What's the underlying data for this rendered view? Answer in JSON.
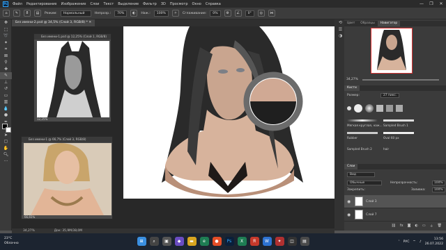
{
  "menu": {
    "items": [
      "Файл",
      "Редактирование",
      "Изображение",
      "Слои",
      "Текст",
      "Выделение",
      "Фильтр",
      "3D",
      "Просмотр",
      "Окно",
      "Справка"
    ]
  },
  "window_controls": [
    "—",
    "❐",
    "✕"
  ],
  "options_bar": {
    "brush_size": "8",
    "mode_label": "Режим:",
    "mode_value": "Нормальный",
    "opacity_label": "Непрозр.:",
    "opacity_value": "70%",
    "flow_label": "Наж.:",
    "flow_value": "100%",
    "smoothing_label": "Сглаживание:",
    "smoothing_value": "0%",
    "angle_value": "0°"
  },
  "document": {
    "tab_title": "Без имени-2.psd @ 34,5% (Слой 3, RGB/8) *",
    "status_zoom": "34,27%",
    "status_doc": "Док: 35,9М/38,0М"
  },
  "float_doc_1": {
    "title": "Без имени-1.psd @ 12,25% (Слой 1, RGB/8)",
    "zoom": "12,25%"
  },
  "float_doc_2": {
    "title": "Без имени-1 @ 66,7% (Слой 3, RGB/8)",
    "zoom": "66,65%"
  },
  "navigator": {
    "tabs": [
      "Цвет",
      "Образцы",
      "Навигатор"
    ],
    "zoom": "34,27%"
  },
  "brushes": {
    "tab": "Кисти",
    "size_label": "Размер:",
    "size_value": "27 пикс.",
    "presets": [
      {
        "label": "Мягкая круглая, наж..."
      },
      {
        "label": "Sampled Brush 1"
      },
      {
        "label": "Rubber"
      },
      {
        "label": "Oval 60 px"
      },
      {
        "label": "Sampled Brush 2"
      },
      {
        "label": "hair"
      }
    ]
  },
  "layers": {
    "tab": "Слои",
    "kind_label": "Вид",
    "blend_mode": "Обычные",
    "opacity_label": "Непрозрачность:",
    "opacity_value": "100%",
    "lock_label": "Закрепить:",
    "fill_label": "Заливка:",
    "fill_value": "100%",
    "items": [
      {
        "name": "Слой 3"
      },
      {
        "name": "Слой 7"
      }
    ]
  },
  "taskbar": {
    "temperature": "23°C",
    "weather": "Облачно",
    "language": "РУС",
    "time": "13:56",
    "date": "26.07.2022"
  },
  "colors": {
    "accent": "#31a8ff",
    "menubar": "#2b2b2b",
    "panel": "#3b3b3b",
    "taskbar": "#1c2430"
  }
}
